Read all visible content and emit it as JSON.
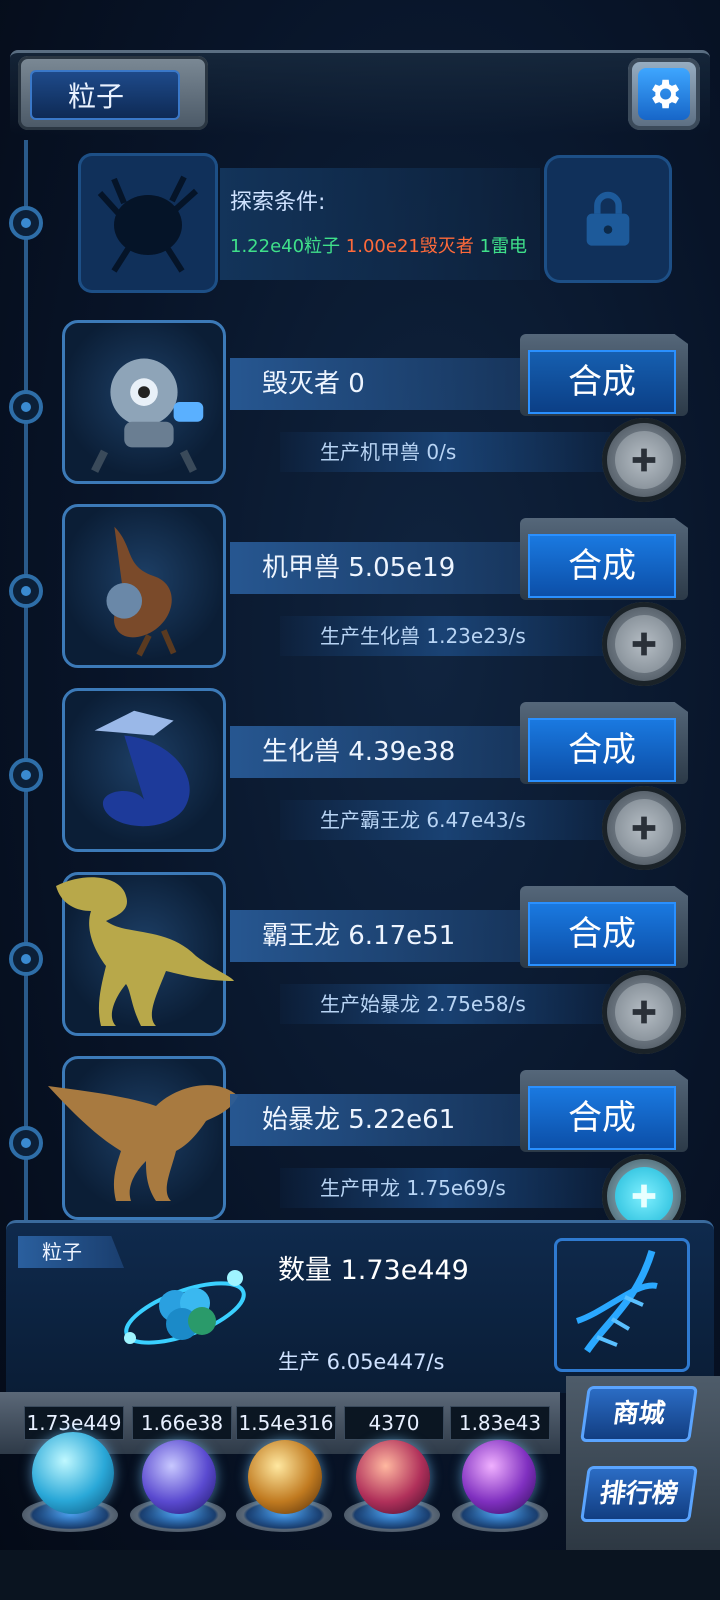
{
  "header": {
    "title": "粒子"
  },
  "locked_item": {
    "condition_label": "探索条件:",
    "requirements": [
      {
        "text": "1.22e40粒子",
        "color": "#3fe08a"
      },
      {
        "text": "1.00e21毁灭者",
        "color": "#ff6a3a"
      },
      {
        "text": "1雷电",
        "color": "#3fe08a"
      }
    ]
  },
  "creatures": [
    {
      "name": "毁灭者 0",
      "production": "生产机甲兽 0/s",
      "combine_label": "合成"
    },
    {
      "name": "机甲兽 5.05e19",
      "production": "生产生化兽 1.23e23/s",
      "combine_label": "合成"
    },
    {
      "name": "生化兽 4.39e38",
      "production": "生产霸王龙 6.47e43/s",
      "combine_label": "合成"
    },
    {
      "name": "霸王龙 6.17e51",
      "production": "生产始暴龙 2.75e58/s",
      "combine_label": "合成"
    },
    {
      "name": "始暴龙 5.22e61",
      "production": "生产甲龙 1.75e69/s",
      "combine_label": "合成"
    }
  ],
  "particle_panel": {
    "tab_label": "粒子",
    "count": "数量 1.73e449",
    "production": "生产 6.05e447/s"
  },
  "resources": [
    {
      "value": "1.73e449",
      "orb": "particle-orb"
    },
    {
      "value": "1.66e38",
      "orb": "lightning-orb"
    },
    {
      "value": "1.54e316",
      "orb": "galaxy-orb"
    },
    {
      "value": "4370",
      "orb": "brain-orb"
    },
    {
      "value": "1.83e43",
      "orb": "vortex-orb"
    }
  ],
  "side_buttons": {
    "shop": "商城",
    "leaderboard": "排行榜"
  }
}
